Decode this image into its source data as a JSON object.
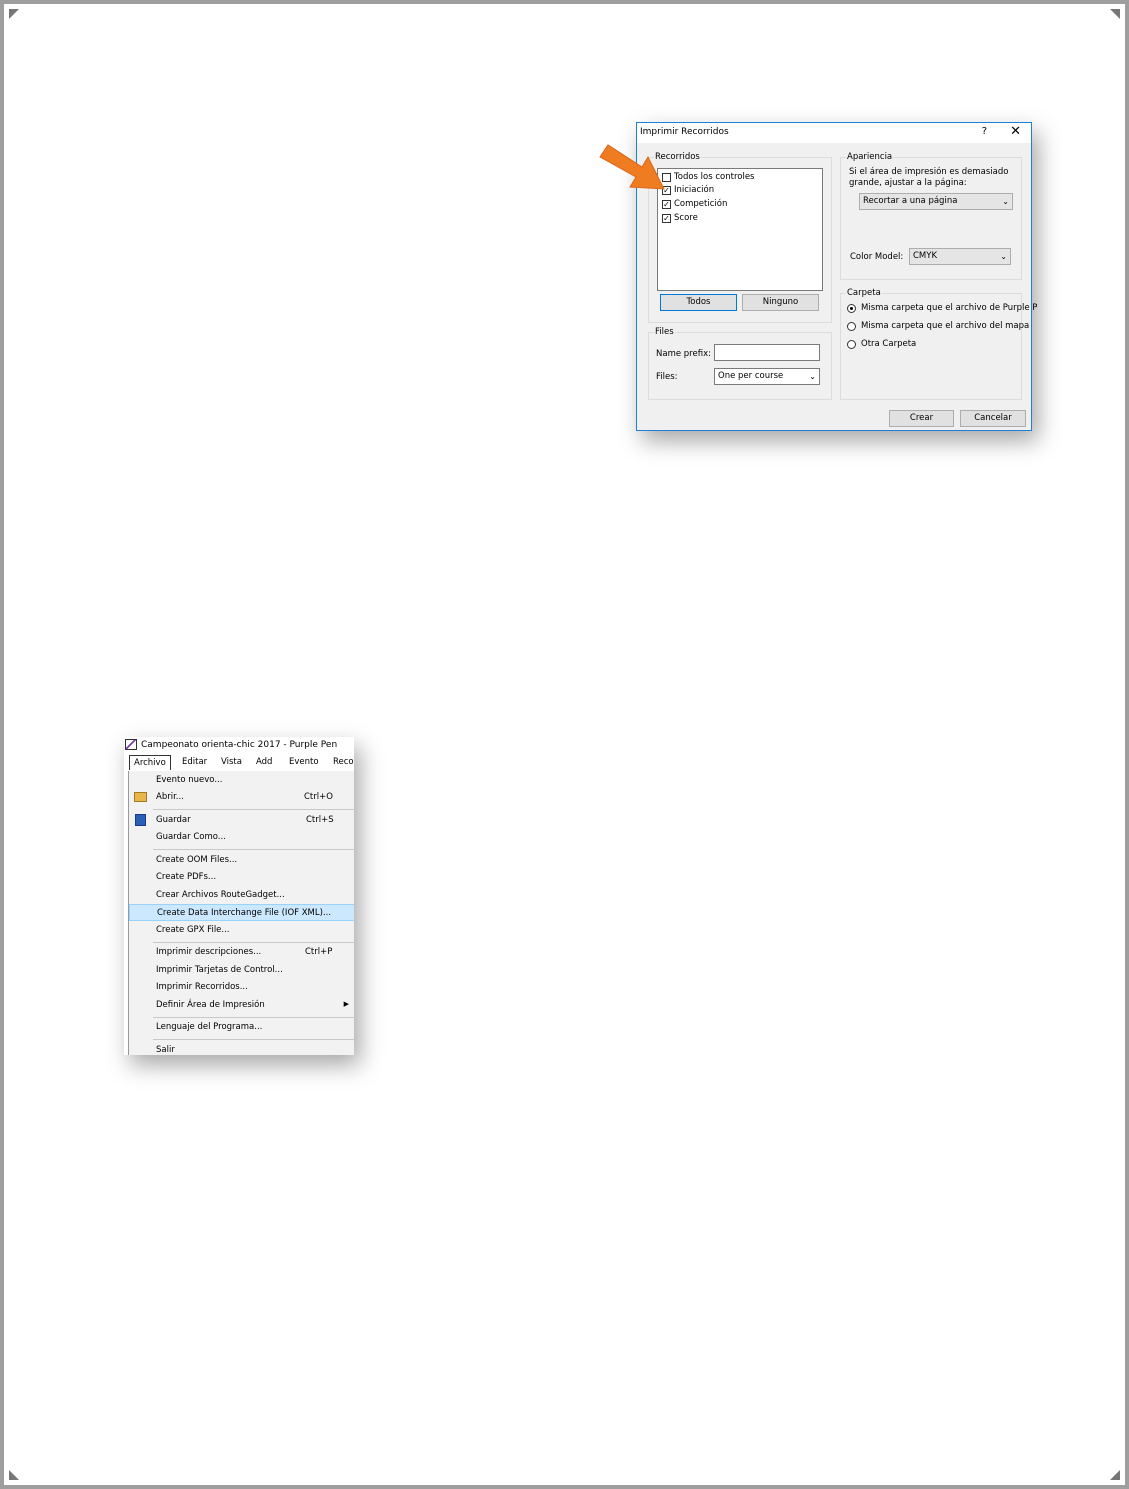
{
  "dialog": {
    "title": "Imprimir Recorridos",
    "help": "?",
    "close": "✕",
    "recorridos": {
      "label": "Recorridos",
      "items": [
        {
          "label": "Todos los controles",
          "checked": false
        },
        {
          "label": "Iniciación",
          "checked": true
        },
        {
          "label": "Competición",
          "checked": true
        },
        {
          "label": "Score",
          "checked": true
        }
      ],
      "all_button": "Todos",
      "none_button": "Ninguno"
    },
    "apariencia": {
      "label": "Apariencia",
      "fit_text": "Si el área de impresión es demasiado grande, ajustar a la página:",
      "fit_value": "Recortar a una página",
      "color_label": "Color Model:",
      "color_value": "CMYK"
    },
    "files": {
      "label": "Files",
      "prefix_label": "Name prefix:",
      "prefix_value": "",
      "files_label": "Files:",
      "files_value": "One per course"
    },
    "carpeta": {
      "label": "Carpeta",
      "options": [
        {
          "label": "Misma carpeta que el archivo de Purple P",
          "selected": true
        },
        {
          "label": "Misma carpeta que el archivo del mapa",
          "selected": false
        },
        {
          "label": "Otra Carpeta",
          "selected": false
        }
      ]
    },
    "create_button": "Crear",
    "cancel_button": "Cancelar"
  },
  "menu_window": {
    "title": "Campeonato orienta-chic 2017 - Purple Pen",
    "menubar": [
      "Archivo",
      "Editar",
      "Vista",
      "Add",
      "Evento",
      "Reco"
    ],
    "items": [
      {
        "label": "Evento nuevo...",
        "shortcut": ""
      },
      {
        "label": "Abrir...",
        "shortcut": "Ctrl+O"
      },
      {
        "label": "Guardar",
        "shortcut": "Ctrl+S"
      },
      {
        "label": "Guardar Como...",
        "shortcut": ""
      },
      {
        "label": "Create OOM Files...",
        "shortcut": ""
      },
      {
        "label": "Create PDFs...",
        "shortcut": ""
      },
      {
        "label": "Crear Archivos RouteGadget...",
        "shortcut": ""
      },
      {
        "label": "Create Data Interchange File (IOF XML)...",
        "shortcut": ""
      },
      {
        "label": "Create GPX File...",
        "shortcut": ""
      },
      {
        "label": "Imprimir descripciones...",
        "shortcut": "Ctrl+P"
      },
      {
        "label": "Imprimir Tarjetas de Control...",
        "shortcut": ""
      },
      {
        "label": "Imprimir Recorridos...",
        "shortcut": ""
      },
      {
        "label": "Definir Área de Impresión",
        "shortcut": ""
      },
      {
        "label": "Lenguaje del Programa...",
        "shortcut": ""
      },
      {
        "label": "Salir",
        "shortcut": ""
      }
    ]
  },
  "colors": {
    "accent_arrow": "#f07c22",
    "dialog_border": "#1e7fd6",
    "highlight": "#cce8ff"
  }
}
